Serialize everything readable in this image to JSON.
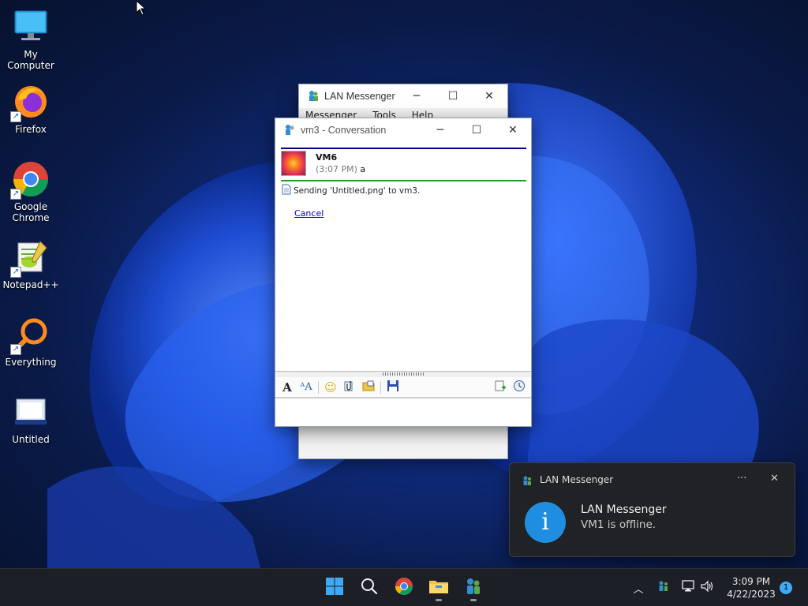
{
  "desktop": {
    "icons": [
      {
        "label_line1": "My Computer",
        "label_line2": ""
      },
      {
        "label_line1": "Firefox",
        "label_line2": ""
      },
      {
        "label_line1": "Google",
        "label_line2": "Chrome"
      },
      {
        "label_line1": "Notepad++",
        "label_line2": ""
      },
      {
        "label_line1": "Everything",
        "label_line2": ""
      },
      {
        "label_line1": "Untitled",
        "label_line2": ""
      }
    ]
  },
  "lan_window": {
    "title": "LAN Messenger",
    "menu": [
      "Messenger",
      "Tools",
      "Help"
    ]
  },
  "conversation": {
    "title": "vm3 - Conversation",
    "message": {
      "sender": "VM6",
      "time": "(3:07 PM)",
      "text": "a"
    },
    "transfer_text": "Sending 'Untitled.png' to vm3.",
    "cancel_label": "Cancel",
    "input_value": ""
  },
  "toast": {
    "app_name": "LAN Messenger",
    "more_label": "···",
    "heading": "LAN Messenger",
    "body": "VM1 is offline."
  },
  "taskbar": {
    "time": "3:09 PM",
    "date": "4/22/2023",
    "notification_count": "1"
  },
  "colors": {
    "accent_blue": "#1a60d0",
    "header_rule": "#000080",
    "message_rule": "#2e9a2e",
    "taskbar_bg": "#1c1f26"
  }
}
